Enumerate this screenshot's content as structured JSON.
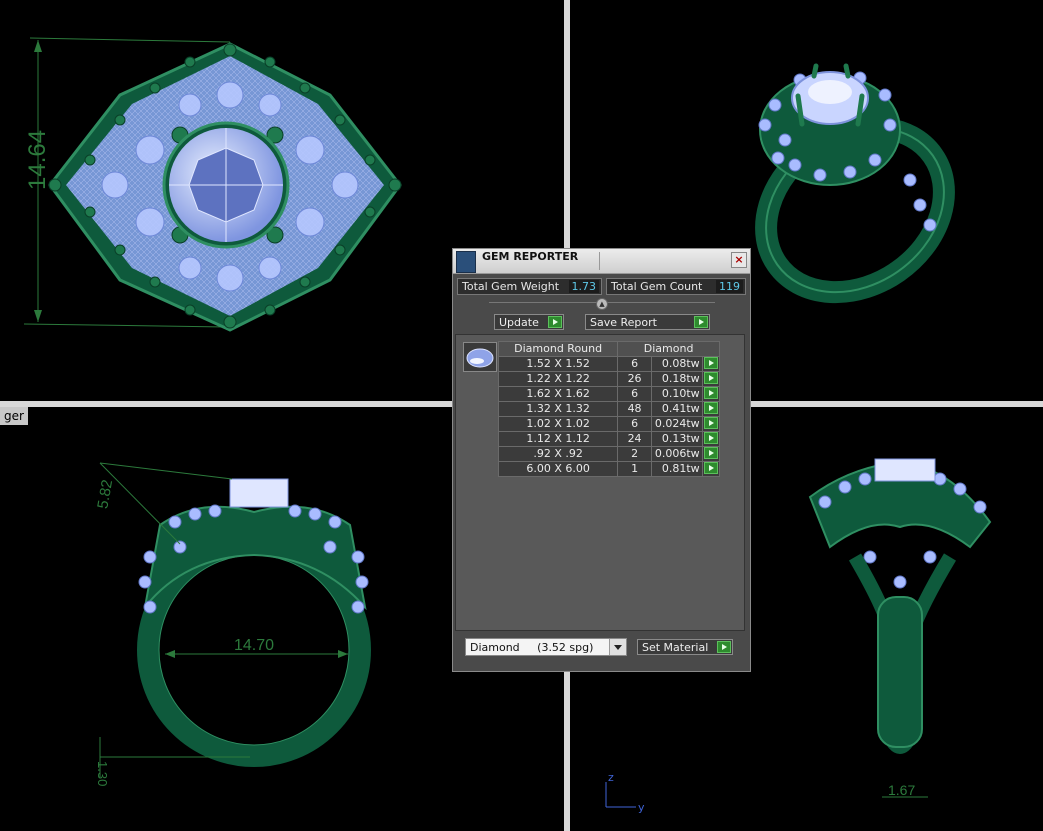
{
  "viewports": {
    "top_view": {
      "dimension": "14.64"
    },
    "perspective_view": {},
    "front_view": {
      "label": "ger",
      "dim_height": "5.82",
      "dim_width": "14.70",
      "dim_shank": "1.30"
    },
    "right_view": {
      "dim_shank": "1.67",
      "axis_z": "z",
      "axis_y": "y"
    }
  },
  "dialog": {
    "title": "GEM REPORTER",
    "close_glyph": "×",
    "total_weight_label": "Total Gem Weight",
    "total_weight_value": "1.73",
    "total_count_label": "Total Gem Count",
    "total_count_value": "119",
    "update_label": "Update",
    "save_report_label": "Save Report",
    "table": {
      "header_shape": "Diamond Round",
      "header_material": "Diamond",
      "rows": [
        {
          "size": "1.52 X 1.52",
          "count": "6",
          "weight": "0.08tw"
        },
        {
          "size": "1.22 X 1.22",
          "count": "26",
          "weight": "0.18tw"
        },
        {
          "size": "1.62 X 1.62",
          "count": "6",
          "weight": "0.10tw"
        },
        {
          "size": "1.32 X 1.32",
          "count": "48",
          "weight": "0.41tw"
        },
        {
          "size": "1.02 X 1.02",
          "count": "6",
          "weight": "0.024tw"
        },
        {
          "size": "1.12 X 1.12",
          "count": "24",
          "weight": "0.13tw"
        },
        {
          "size": ".92 X .92",
          "count": "2",
          "weight": "0.006tw"
        },
        {
          "size": "6.00 X 6.00",
          "count": "1",
          "weight": "0.81tw"
        }
      ]
    },
    "material_select": "Diamond     (3.52 spg)",
    "set_material_label": "Set Material"
  },
  "colors": {
    "metal": "#0e5a3c",
    "metal_edge": "#2f8f62",
    "gem": "#9fb6ff",
    "dimension": "#2c7a3c",
    "axis": "#3f64d8"
  }
}
